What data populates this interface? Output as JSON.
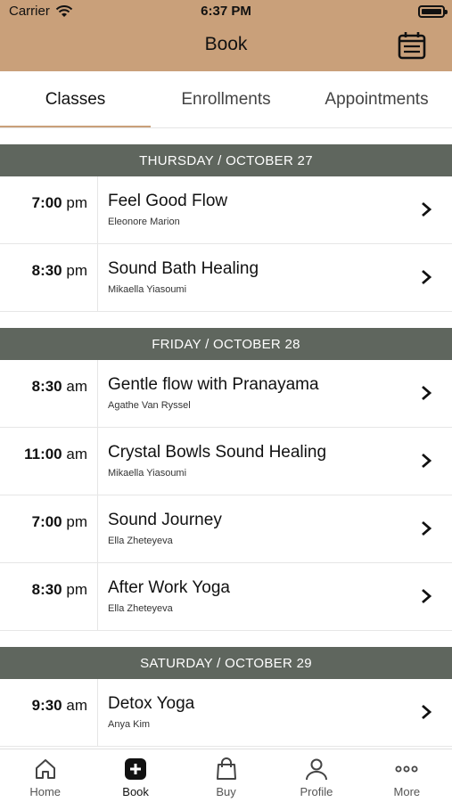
{
  "status_bar": {
    "carrier": "Carrier",
    "time": "6:37 PM"
  },
  "header": {
    "title": "Book"
  },
  "tabs": [
    {
      "label": "Classes"
    },
    {
      "label": "Enrollments"
    },
    {
      "label": "Appointments"
    }
  ],
  "days": [
    {
      "label": "THURSDAY / OCTOBER 27",
      "classes": [
        {
          "time": "7:00",
          "ampm": "pm",
          "name": "Feel Good Flow",
          "teacher": "Eleonore Marion"
        },
        {
          "time": "8:30",
          "ampm": "pm",
          "name": "Sound Bath Healing",
          "teacher": "Mikaella Yiasoumi"
        }
      ]
    },
    {
      "label": "FRIDAY / OCTOBER 28",
      "classes": [
        {
          "time": "8:30",
          "ampm": "am",
          "name": "Gentle flow with Pranayama",
          "teacher": "Agathe Van Ryssel"
        },
        {
          "time": "11:00",
          "ampm": "am",
          "name": "Crystal Bowls Sound Healing",
          "teacher": "Mikaella Yiasoumi"
        },
        {
          "time": "7:00",
          "ampm": "pm",
          "name": "Sound Journey",
          "teacher": "Ella Zheteyeva"
        },
        {
          "time": "8:30",
          "ampm": "pm",
          "name": "After Work Yoga",
          "teacher": "Ella Zheteyeva"
        }
      ]
    },
    {
      "label": "SATURDAY / OCTOBER 29",
      "classes": [
        {
          "time": "9:30",
          "ampm": "am",
          "name": "Detox Yoga",
          "teacher": "Anya Kim"
        }
      ]
    }
  ],
  "bottom_nav": [
    {
      "label": "Home",
      "icon": "home-icon"
    },
    {
      "label": "Book",
      "icon": "plus-square-icon"
    },
    {
      "label": "Buy",
      "icon": "shopping-bag-icon"
    },
    {
      "label": "Profile",
      "icon": "person-icon"
    },
    {
      "label": "More",
      "icon": "more-icon"
    }
  ],
  "colors": {
    "header": "#c9a07a",
    "day_header": "#5f665e",
    "active_tab_underline": "#c9a07a"
  }
}
